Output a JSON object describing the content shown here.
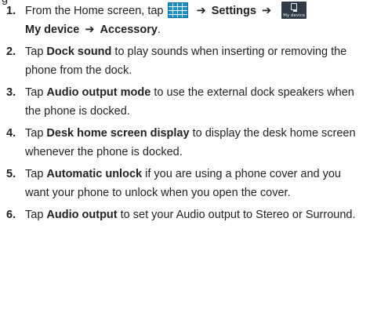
{
  "header_fragment": "g",
  "icons": {
    "apps_grid": "apps-grid-icon",
    "my_device": "my-device-icon",
    "my_device_caption": "My device",
    "arrow": "➔",
    "accent": "#1a8fd0"
  },
  "steps": [
    {
      "number": "1.",
      "t1": "From the Home screen, tap",
      "t2": "Settings",
      "t3": "My device",
      "t4": "Accessory",
      "t5": "."
    },
    {
      "number": "2.",
      "t1": "Tap ",
      "bold": "Dock sound",
      "t2": " to play sounds when inserting or removing the phone from the dock."
    },
    {
      "number": "3.",
      "t1": "Tap ",
      "bold": "Audio output mode",
      "t2": " to use the external dock speakers when the phone is docked."
    },
    {
      "number": "4.",
      "t1": "Tap ",
      "bold": "Desk home screen display",
      "t2": " to display the desk home screen whenever the phone is docked."
    },
    {
      "number": "5.",
      "t1": "Tap ",
      "bold": "Automatic unlock",
      "t2": " if you are using a phone cover and you want your phone to unlock when you open the cover."
    },
    {
      "number": "6.",
      "t1": "Tap ",
      "bold": "Audio output",
      "t2": " to set your Audio output to Stereo or Surround."
    }
  ]
}
